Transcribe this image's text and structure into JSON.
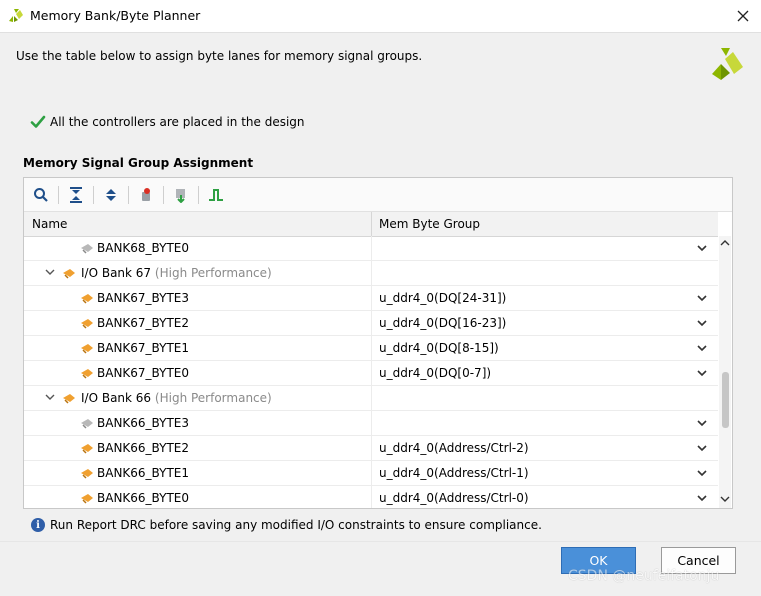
{
  "window": {
    "title": "Memory Bank/Byte Planner"
  },
  "instruction": "Use the table below to assign byte lanes for memory signal groups.",
  "status": {
    "text": "All the controllers are placed in the design"
  },
  "section_title": "Memory Signal Group Assignment",
  "table": {
    "headers": {
      "name": "Name",
      "group": "Mem Byte Group"
    },
    "rows": [
      {
        "name": "BANK68_BYTE0",
        "sub": "",
        "value": "",
        "indent": 2
      },
      {
        "name": "I/O Bank 67",
        "sub": "(High Performance)",
        "value": "",
        "indent": 1
      },
      {
        "name": "BANK67_BYTE3",
        "sub": "",
        "value": "u_ddr4_0(DQ[24-31])",
        "indent": 2
      },
      {
        "name": "BANK67_BYTE2",
        "sub": "",
        "value": "u_ddr4_0(DQ[16-23])",
        "indent": 2
      },
      {
        "name": "BANK67_BYTE1",
        "sub": "",
        "value": "u_ddr4_0(DQ[8-15])",
        "indent": 2
      },
      {
        "name": "BANK67_BYTE0",
        "sub": "",
        "value": "u_ddr4_0(DQ[0-7])",
        "indent": 2
      },
      {
        "name": "I/O Bank 66",
        "sub": "(High Performance)",
        "value": "",
        "indent": 1
      },
      {
        "name": "BANK66_BYTE3",
        "sub": "",
        "value": "",
        "indent": 2
      },
      {
        "name": "BANK66_BYTE2",
        "sub": "",
        "value": "u_ddr4_0(Address/Ctrl-2)",
        "indent": 2
      },
      {
        "name": "BANK66_BYTE1",
        "sub": "",
        "value": "u_ddr4_0(Address/Ctrl-1)",
        "indent": 2
      },
      {
        "name": "BANK66_BYTE0",
        "sub": "",
        "value": "u_ddr4_0(Address/Ctrl-0)",
        "indent": 2
      }
    ]
  },
  "info": {
    "text": "Run Report DRC before saving any modified I/O constraints to ensure compliance."
  },
  "buttons": {
    "ok": "OK",
    "cancel": "Cancel"
  },
  "watermark": "CSDN @neufeifatonju",
  "icons": {
    "title": "xilinx-logo-icon",
    "close": "close-icon",
    "status": "checkmark-icon",
    "toolbar": [
      "search-icon",
      "collapse-all-icon",
      "expand-all-icon",
      "auto-assign-icon",
      "export-icon",
      "signal-icon"
    ],
    "info": "info-icon",
    "brand": "xilinx-logo-icon"
  },
  "colors": {
    "accent": "#4a90d9",
    "check": "#2ea043",
    "brand_green": "#8db600",
    "info_blue": "#2f5ea8"
  }
}
